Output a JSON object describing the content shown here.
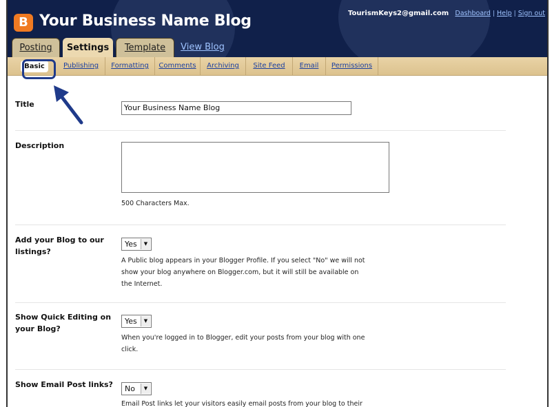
{
  "header": {
    "blog_title": "Your Business Name Blog",
    "logo_letter": "B",
    "account_email": "TourismKeys2@gmail.com",
    "links": [
      "Dashboard",
      "Help",
      "Sign out"
    ],
    "bg_color": "#10204a",
    "accent_color": "#f07a22"
  },
  "tabs": [
    {
      "label": "Posting",
      "active": false
    },
    {
      "label": "Settings",
      "active": true
    },
    {
      "label": "Template",
      "active": false
    },
    {
      "label": "View Blog",
      "active": false
    }
  ],
  "subnav": [
    "Basic",
    "Publishing",
    "Formatting",
    "Comments",
    "Archiving",
    "Site Feed",
    "Email",
    "Permissions"
  ],
  "form": {
    "title": {
      "label": "Title",
      "value": "Your Business Name Blog"
    },
    "description": {
      "label": "Description",
      "value": "",
      "note": "500 Characters Max."
    },
    "listings": {
      "label_lines": [
        "Add your Blog to our",
        "listings?"
      ],
      "value": "Yes",
      "note_lines": [
        "A Public blog appears in your Blogger Profile. If you select \"No\" we will not",
        "show your blog anywhere on Blogger.com, but it will still be available on",
        "the Internet."
      ]
    },
    "quick_editing": {
      "label_lines": [
        "Show Quick Editing on",
        "your Blog?"
      ],
      "value": "Yes",
      "note_lines": [
        "When you're logged in to Blogger, edit your posts from your blog with one",
        "click."
      ]
    },
    "email_post": {
      "label_lines": [
        "Show Email Post links?"
      ],
      "value": "No",
      "note_lines": [
        "Email Post links let your visitors easily email posts from your blog to their"
      ]
    }
  }
}
